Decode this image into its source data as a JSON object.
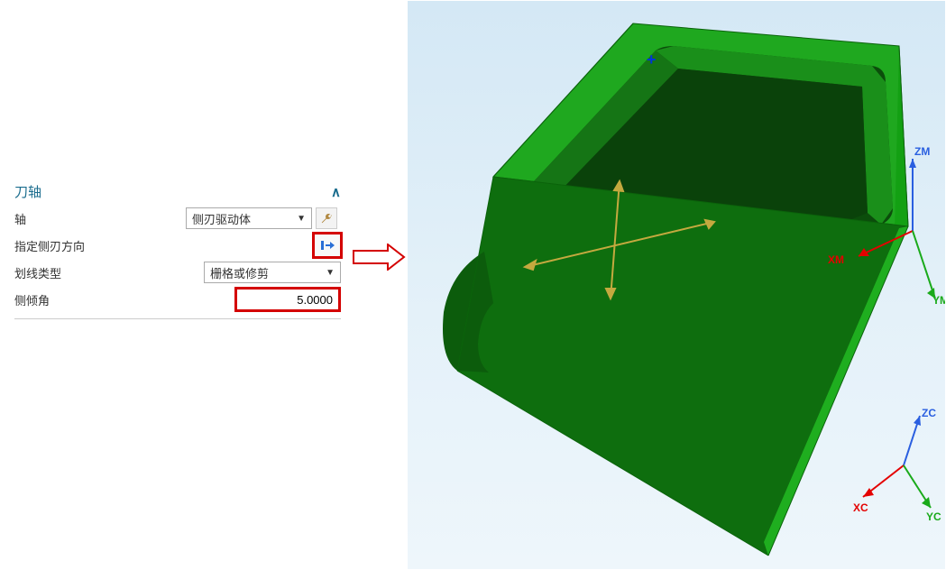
{
  "section": {
    "title": "刀轴"
  },
  "axis": {
    "label": "轴",
    "value": "侧刃驱动体"
  },
  "direction": {
    "label": "指定侧刃方向"
  },
  "line_type": {
    "label": "划线类型",
    "value": "栅格或修剪"
  },
  "tilt_angle": {
    "label": "侧倾角",
    "value": "5.0000"
  },
  "triad_machine": {
    "x": "XM",
    "y": "YM",
    "z": "ZM"
  },
  "triad_csys": {
    "x": "XC",
    "y": "YC",
    "z": "ZC"
  }
}
